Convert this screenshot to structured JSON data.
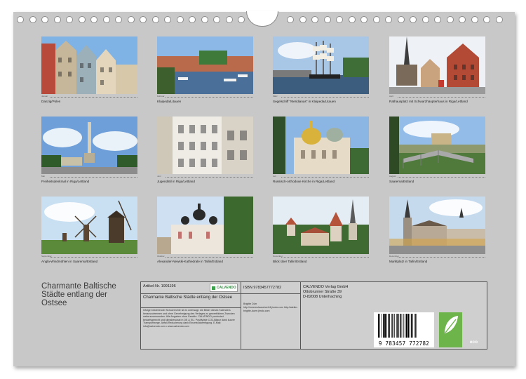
{
  "calendar": {
    "title": "Charmante Baltische Städte entlang der Ostsee",
    "photos": [
      {
        "caption": "Danzig/Polen",
        "month": "Januar"
      },
      {
        "caption": "Klaipeda/Litauen",
        "month": "Februar"
      },
      {
        "caption": "Segelschiff \"Meridianas\" in Klaipeda/Litauen",
        "month": "März"
      },
      {
        "caption": "Rathausplatz mit Schwarzhäupterhaus in Riga/Lettland",
        "month": "April"
      },
      {
        "caption": "Freiheitsdenkmal in Riga/Lettland",
        "month": "Mai"
      },
      {
        "caption": "Jugendstil in Riga/Lettland",
        "month": "Juni"
      },
      {
        "caption": "Russisch-orthodoxe Kirche in Riga/Lettland",
        "month": "Juli"
      },
      {
        "caption": "Saarema/Estland",
        "month": "August"
      },
      {
        "caption": "Angla-Windmühlen in Saarema/Estland",
        "month": "September"
      },
      {
        "caption": "Alexander-Newski-Kathedrale in Tallin/Estland",
        "month": "Oktober"
      },
      {
        "caption": "Blick über Tallin/Estland",
        "month": "November"
      },
      {
        "caption": "Marktplatz in Tallin/Estland",
        "month": "Dezember"
      }
    ]
  },
  "info": {
    "article": "Artikel-Nr. 1991196",
    "brand": "CALVENDO",
    "product_title": "Charmante Baltische Städte entlang der Ostsee",
    "legal": "Infolge bestehender Schutzrechte ist es untersagt, die Bilder dieses Kalenders herauszutrennen und ohne Genehmigung des Verlages zu gewerblichen Zwecken weiterzuverwenden. Alle Angaben ohne Gewähr. CALVENDO produziert bedarfsgerecht und klimabewusst in DE & EU. Positivliste CO2-Bilanz dank kurzer Transportwege. Abfall-Reduzierung dank Einzelstückfertigung. E-Mail: info@calvendo.com • www.calvendo.com",
    "isbn": "ISBN 9783457772782",
    "author": "Brigitte Dürr",
    "author_links": "http://meereslauschen04.jimdo.com http://atelier-brigitte-duerr.jimdo.com",
    "publisher": "CALVENDO Verlag GmbH",
    "street": "Ottobrunner Straße 39",
    "city": "D-82008 Unterhaching",
    "barcode_digits": "9 783457 772782",
    "eco_label": "eco"
  }
}
